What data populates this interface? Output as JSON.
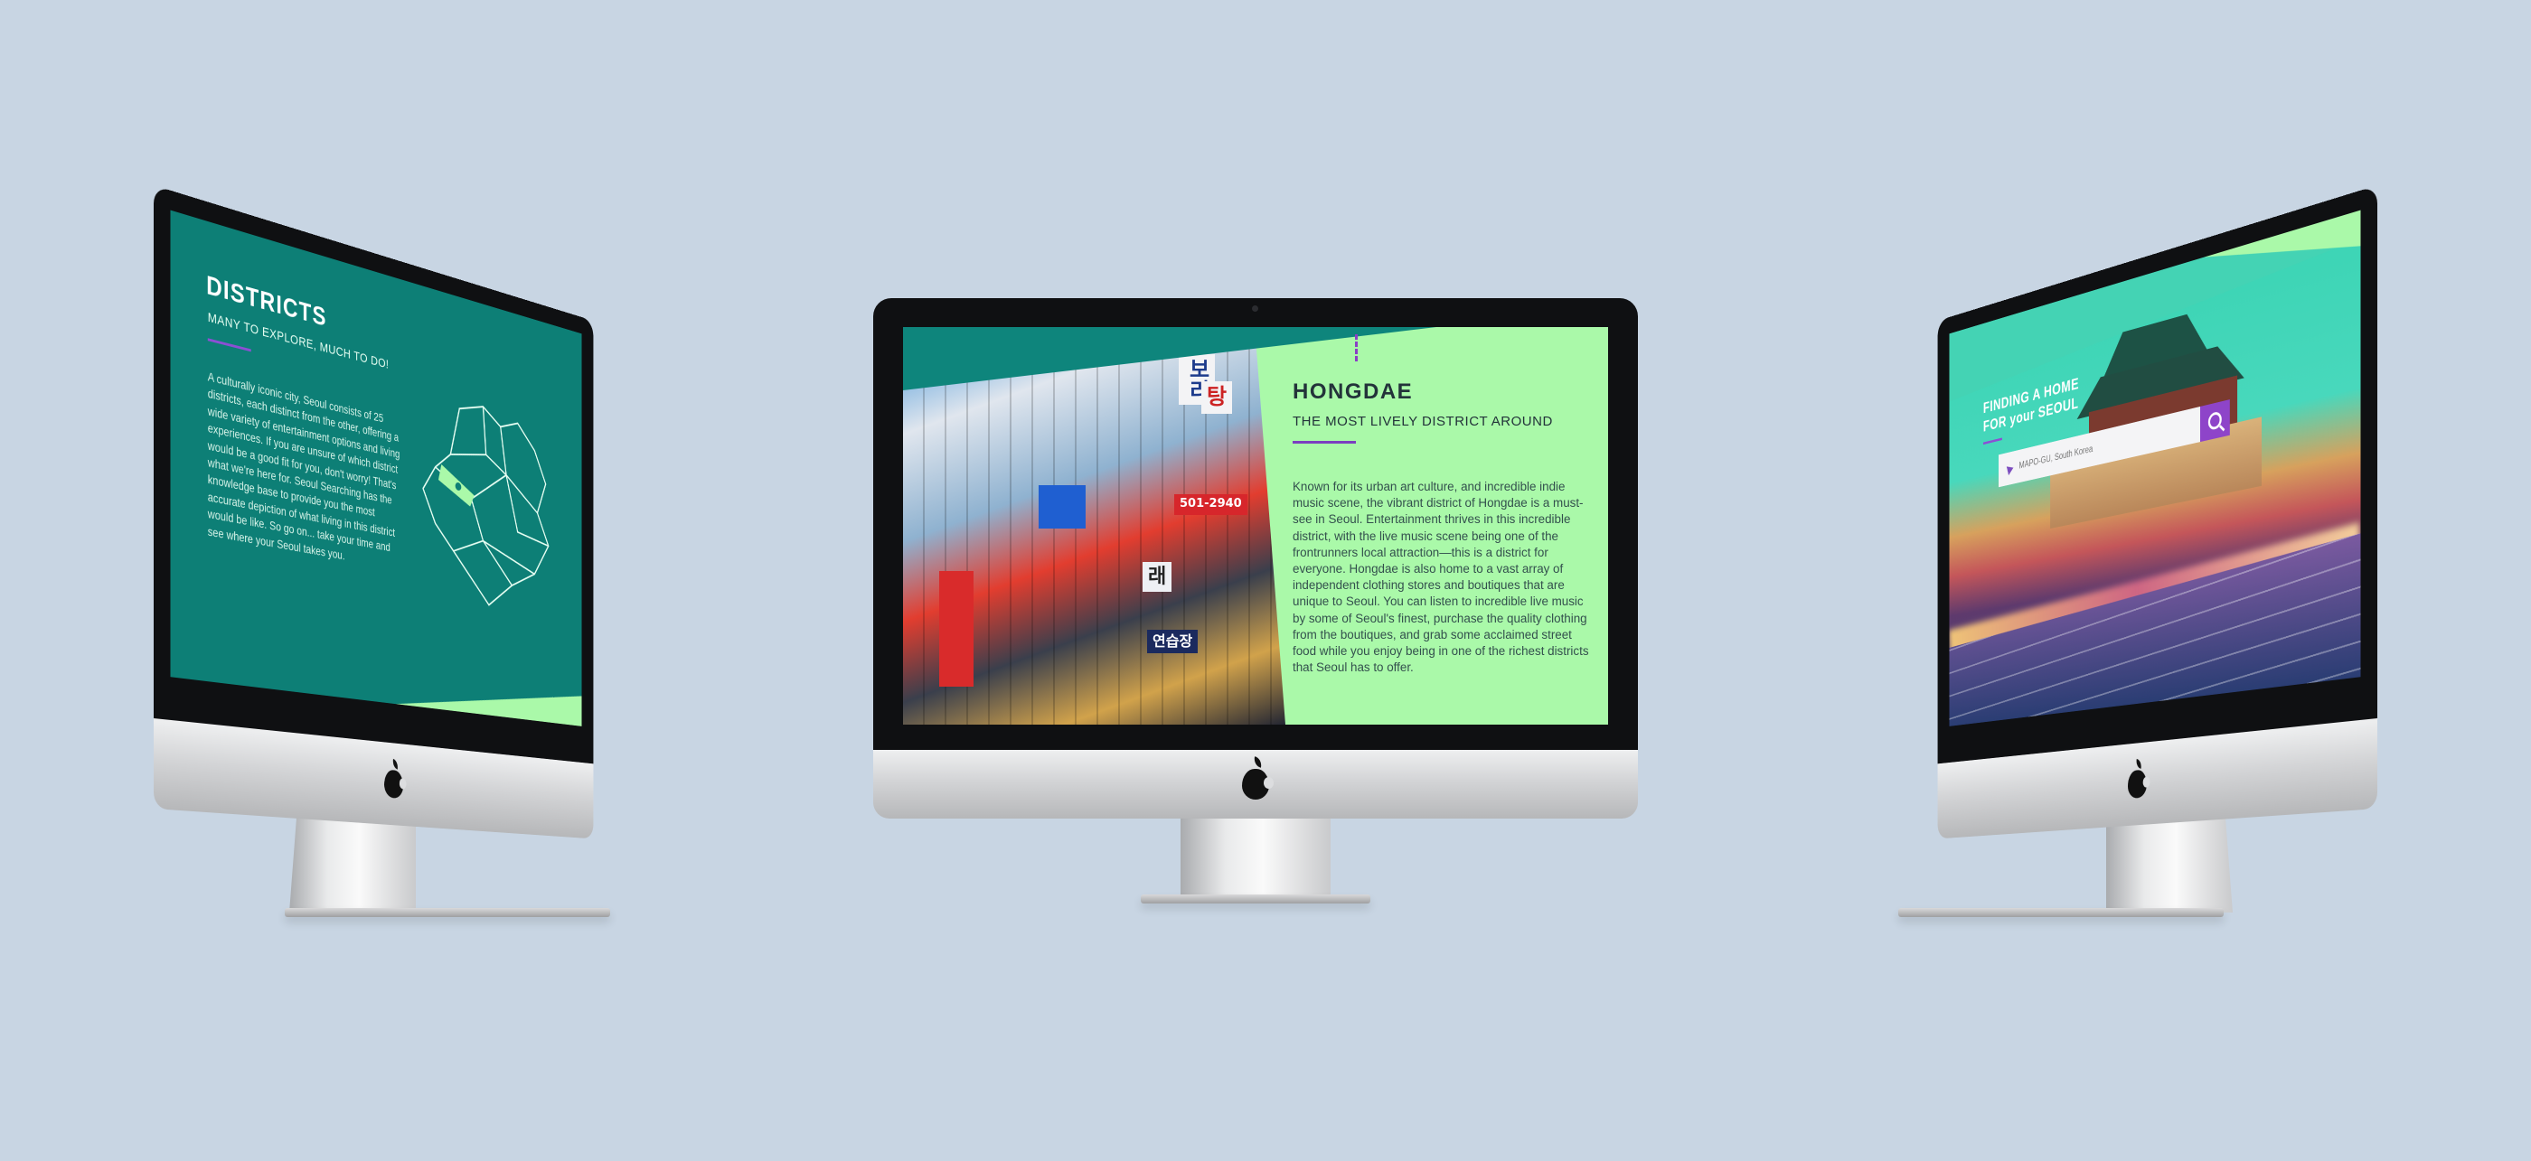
{
  "left_screen": {
    "title": "DISTRICTS",
    "subtitle": "MANY TO EXPLORE, MUCH TO DO!",
    "body": "A culturally iconic city, Seoul consists of 25 districts, each distinct from the other, offering a wide variety of entertainment options and living experiences. If you are unsure of which district would be a good fit for you, don't worry! That's what we're here for. Seoul Searching has the knowledge base to provide you the most accurate depiction of what living in this district would be like. So go on... take your time and see where your Seoul takes you."
  },
  "center_screen": {
    "title": "HONGDAE",
    "subtitle": "THE MOST LIVELY DISTRICT AROUND",
    "body": "Known for its urban art culture, and incredible indie music scene, the vibrant district of Hongdae is a must-see in Seoul. Entertainment thrives in this incredible district, with the live music scene being one of the frontrunners local attraction—this is a district for everyone. Hongdae is also home to a vast array of independent clothing stores and boutiques that are unique to Seoul. You can listen to incredible live music by some of Seoul's finest, purchase the quality clothing from the boutiques, and grab some acclaimed street food while you enjoy being in one of the richest districts that Seoul has to offer.",
    "photo_signs": [
      "보리",
      "탕",
      "501-2940",
      "래",
      "연습장"
    ]
  },
  "right_screen": {
    "title": "FINDING A HOME\nFOR your SEOUL",
    "search_placeholder": "MAPO-GU, South Korea"
  },
  "colors": {
    "background": "#c8d5e3",
    "teal": "#0d7f76",
    "mint": "#aaf9a9",
    "purple": "#8e44c9"
  },
  "icons": [
    "apple-logo-icon",
    "location-pin-icon",
    "search-icon"
  ]
}
